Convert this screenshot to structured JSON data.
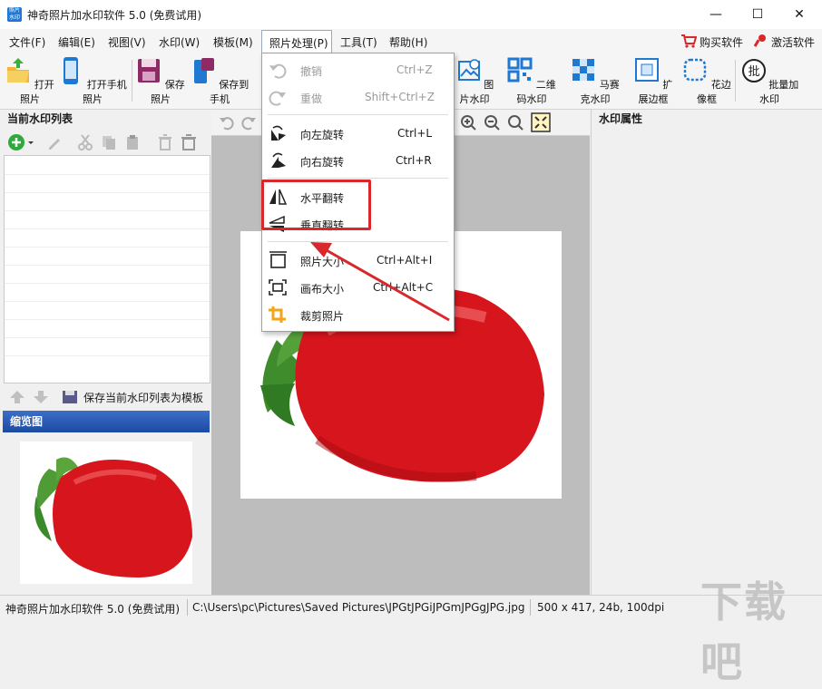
{
  "window": {
    "title": "神奇照片加水印软件 5.0 (免费试用)",
    "app_icon_text": "照片\n水印",
    "minimize": "—",
    "maximize": "☐",
    "close": "✕"
  },
  "menubar": {
    "items": [
      "文件(F)",
      "编辑(E)",
      "视图(V)",
      "水印(W)",
      "模板(M)",
      "照片处理(P)",
      "工具(T)",
      "帮助(H)"
    ],
    "buy": "购买软件",
    "activate": "激活软件"
  },
  "toolbar": {
    "open_photo": "打开照片",
    "open_phone_photo": "打开手机照片",
    "save_photo": "保存照片",
    "save_to_phone": "保存到手机",
    "image_watermark": "图片水印",
    "qr_watermark": "二维码水印",
    "mosaic_watermark": "马赛克水印",
    "expand_border": "扩展边框",
    "flower_border": "花边像框",
    "batch_watermark": "批量加水印"
  },
  "left_panel": {
    "list_title": "当前水印列表",
    "save_template": "保存当前水印列表为模板",
    "thumb_title": "缩览图"
  },
  "right_panel": {
    "title": "水印属性"
  },
  "dropdown": {
    "undo": {
      "label": "撤销",
      "shortcut": "Ctrl+Z"
    },
    "redo": {
      "label": "重做",
      "shortcut": "Shift+Ctrl+Z"
    },
    "rotate_left": {
      "label": "向左旋转",
      "shortcut": "Ctrl+L"
    },
    "rotate_right": {
      "label": "向右旋转",
      "shortcut": "Ctrl+R"
    },
    "flip_h": {
      "label": "水平翻转"
    },
    "flip_v": {
      "label": "垂直翻转"
    },
    "photo_size": {
      "label": "照片大小",
      "shortcut": "Ctrl+Alt+I"
    },
    "canvas_size": {
      "label": "画布大小",
      "shortcut": "Ctrl+Alt+C"
    },
    "crop": {
      "label": "裁剪照片"
    }
  },
  "statusbar": {
    "app": "神奇照片加水印软件 5.0 (免费试用)",
    "path": "C:\\Users\\pc\\Pictures\\Saved Pictures\\JPGtJPGiJPGmJPGgJPG.jpg",
    "info": "500 x 417, 24b, 100dpi"
  },
  "watermark": "下载吧",
  "colors": {
    "accent_blue": "#1f78d1",
    "highlight_red": "#d8282c",
    "thumb_header": "#2a5cb5"
  }
}
